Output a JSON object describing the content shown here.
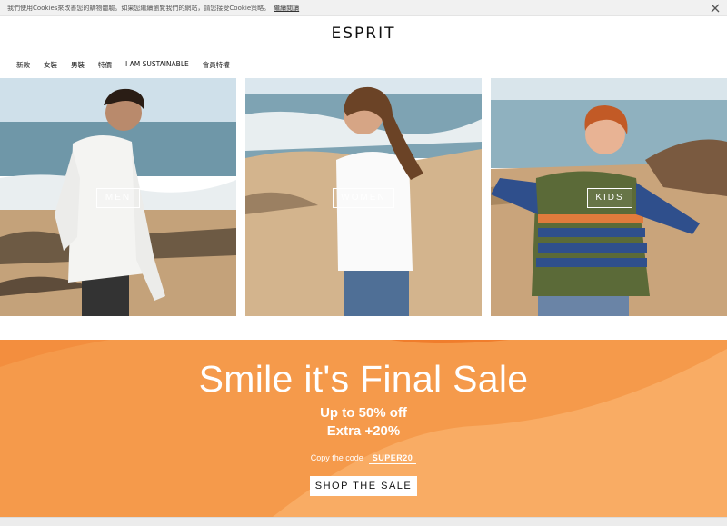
{
  "cookie": {
    "message": "我們使用Cookies來改善您的購物體驗。如果您繼續瀏覽我們的網站，請您接受Cookie策略。",
    "link": "繼續閱讀"
  },
  "header": {
    "logo": "ESPRIT",
    "nav": [
      "新款",
      "女裝",
      "男裝",
      "特價",
      "I AM SUSTAINABLE",
      "會員特權"
    ]
  },
  "tiles": [
    {
      "label": "MEN"
    },
    {
      "label": "WOMEN"
    },
    {
      "label": "KIDS"
    }
  ],
  "sale": {
    "title": "Smile it's Final Sale",
    "line1": "Up to 50% off",
    "line2": "Extra +20%",
    "code_prompt": "Copy the code",
    "code": "SUPER20",
    "button": "SHOP THE SALE"
  },
  "icons": {
    "close": "close-icon"
  },
  "colors": {
    "sale_background": "#f59a4b",
    "cookie_bar": "#f1f1f1"
  }
}
